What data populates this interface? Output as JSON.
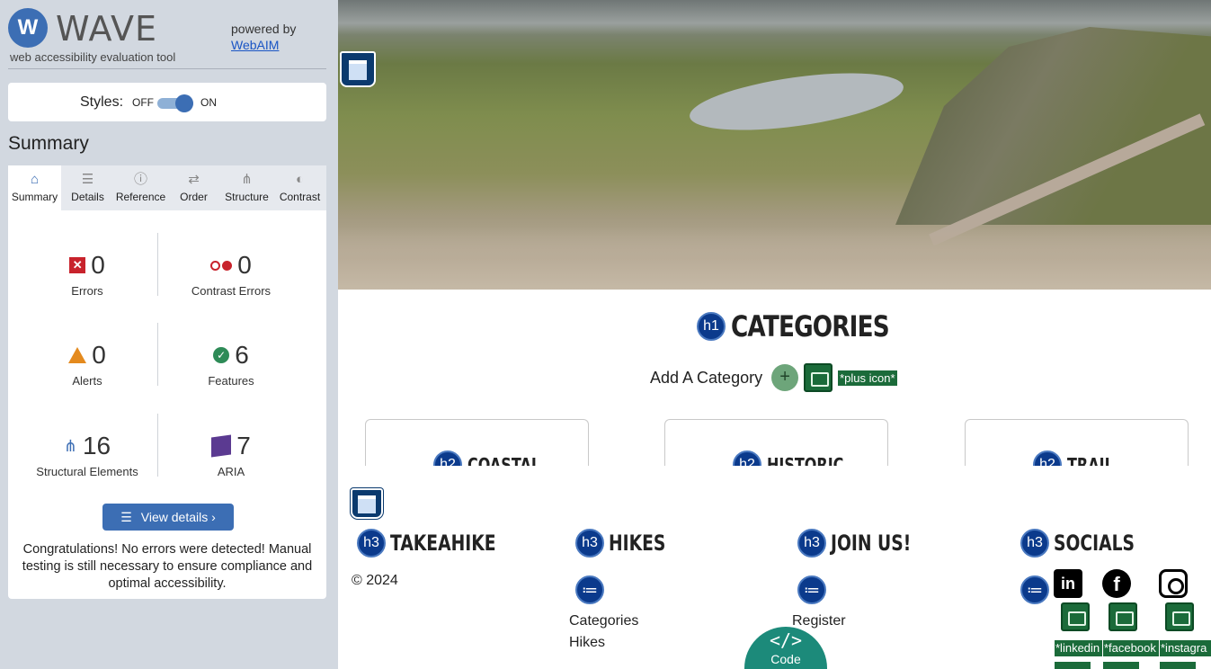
{
  "wave": {
    "logo_letter": "W",
    "logo_word": "WAVE",
    "tagline": "web accessibility evaluation tool",
    "powered_by": "powered by",
    "powered_link": "WebAIM",
    "styles_label": "Styles:",
    "toggle_off": "OFF",
    "toggle_on": "ON",
    "toggle_state": "on",
    "summary_heading": "Summary",
    "tabs": [
      {
        "label": "Summary",
        "icon": "home-icon",
        "active": true
      },
      {
        "label": "Details",
        "icon": "list-icon",
        "active": false
      },
      {
        "label": "Reference",
        "icon": "info-icon",
        "active": false
      },
      {
        "label": "Order",
        "icon": "order-icon",
        "active": false
      },
      {
        "label": "Structure",
        "icon": "structure-icon",
        "active": false
      },
      {
        "label": "Contrast",
        "icon": "contrast-icon",
        "active": false
      }
    ],
    "stats": {
      "errors": {
        "count": "0",
        "label": "Errors"
      },
      "contrast_errors": {
        "count": "0",
        "label": "Contrast Errors"
      },
      "alerts": {
        "count": "0",
        "label": "Alerts"
      },
      "features": {
        "count": "6",
        "label": "Features"
      },
      "structural": {
        "count": "16",
        "label": "Structural Elements"
      },
      "aria": {
        "count": "7",
        "label": "ARIA"
      }
    },
    "view_details": "View details ›",
    "congrats": "Congratulations! No errors were detected! Manual testing is still necessary to ensure compliance and optimal accessibility."
  },
  "page": {
    "categories": {
      "badge": "h1",
      "title": "CATEGORIES"
    },
    "add_category": {
      "label": "Add A Category",
      "plus": "+",
      "alt": "*plus icon*"
    },
    "cards": [
      {
        "badge": "h2",
        "title": "COASTAL"
      },
      {
        "badge": "h2",
        "title": "HISTORIC"
      },
      {
        "badge": "h2",
        "title": "TRAIL"
      }
    ],
    "footer": {
      "cols": [
        {
          "badge": "h3",
          "title": "TAKEAHIKE"
        },
        {
          "badge": "h3",
          "title": "HIKES"
        },
        {
          "badge": "h3",
          "title": "JOIN US!"
        },
        {
          "badge": "h3",
          "title": "SOCIALS"
        }
      ],
      "copyright": "© 2024",
      "hikes_links": [
        "Categories",
        "Hikes"
      ],
      "join_links": [
        "Register"
      ],
      "social_alts": [
        "*linkedin",
        "*facebook",
        "*instagra"
      ],
      "linkedin_glyph": "in",
      "facebook_glyph": "f"
    },
    "code_button": {
      "symbol": "</>",
      "label": "Code"
    }
  },
  "colors": {
    "wave_blue": "#3c6eb4",
    "error_red": "#c8232c",
    "alert_orange": "#e48a1e",
    "feature_green": "#2e8b57",
    "aria_purple": "#5b3a91",
    "alt_green": "#1b6b3a",
    "code_teal": "#1c8a7a"
  }
}
